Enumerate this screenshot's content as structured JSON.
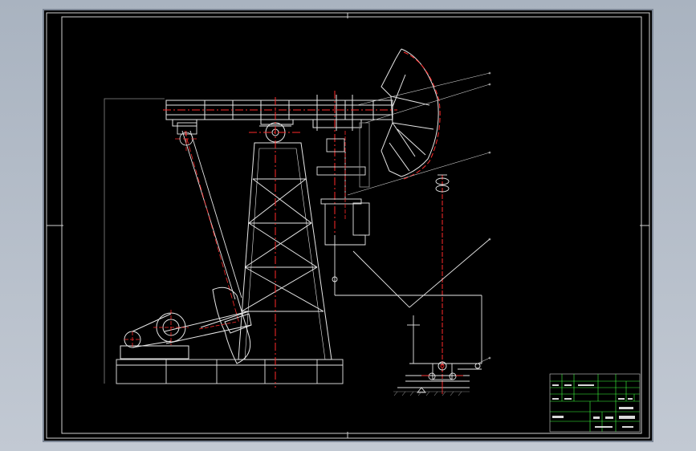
{
  "viewport": {
    "background": "#b4bdc9"
  },
  "drawing": {
    "background": "#000000",
    "colors": {
      "frame": "#cfcfcf",
      "outline": "#e6e6e6",
      "centerline": "#ff2a2a",
      "titleblock_grid": "#3cff3c"
    },
    "elements": [
      "drawing-frame",
      "walking-beam",
      "horse-head",
      "samson-post",
      "pitman-arm",
      "crank-counterweight",
      "gear-reducer",
      "base-skid",
      "polished-rod",
      "wellhead",
      "pipeline",
      "leader-lines",
      "title-block"
    ]
  }
}
